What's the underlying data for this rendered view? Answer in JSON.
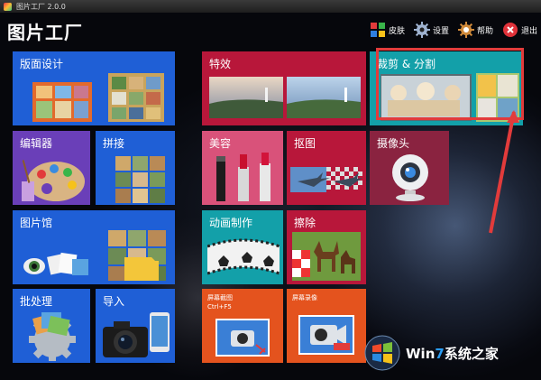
{
  "window": {
    "title": "图片工厂 2.0.0"
  },
  "header": {
    "title": "图片工厂"
  },
  "toolbar": {
    "skin_label": "皮肤",
    "settings_label": "设置",
    "help_label": "帮助",
    "exit_label": "退出"
  },
  "tiles": {
    "layout_design": "版面设计",
    "effects": "特效",
    "crop_split": "裁剪 & 分割",
    "editor": "编辑器",
    "stitch": "拼接",
    "beauty": "美容",
    "cutout": "抠图",
    "camera": "摄像头",
    "gallery": "图片馆",
    "animation": "动画制作",
    "erase": "擦除",
    "batch": "批处理",
    "import": "导入",
    "screenshot": "屏幕截图",
    "screenshot_hotkey": "Ctrl+F5",
    "screen_record": "屏幕录像"
  },
  "watermark": {
    "prefix": "Wi",
    "n": "n",
    "seven": "7",
    "suffix": "系统之家"
  },
  "colors": {
    "blue": "#1f5fd6",
    "red": "#b8173a",
    "teal": "#13a0a9",
    "purple": "#6a3fb8",
    "pink": "#d9527a",
    "maroon": "#8a2340",
    "orange": "#e4531e",
    "highlight": "#e23b3b"
  }
}
